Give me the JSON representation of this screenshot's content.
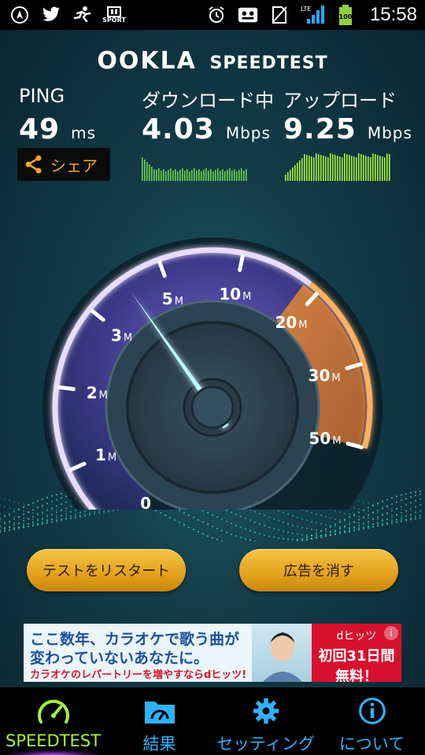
{
  "status_bar": {
    "time": "15:58",
    "network": "LTE",
    "battery": "100",
    "sport_label": "SPORT",
    "icons_left": [
      "navigation-icon",
      "twitter-icon",
      "runner-icon",
      "sport-app-icon"
    ],
    "icons_right": [
      "alarm-icon",
      "voicemail-icon",
      "no-sim-icon",
      "signal-icon",
      "battery-icon"
    ]
  },
  "app": {
    "logo_ookla": "OOKLA",
    "logo_speedtest": "SPEEDTEST",
    "ping": {
      "label": "PING",
      "value": "49",
      "unit": "ms"
    },
    "download": {
      "label": "ダウンロード中",
      "value": "4.03",
      "unit": "Mbps"
    },
    "upload": {
      "label": "アップロード",
      "value": "9.25",
      "unit": "Mbps"
    },
    "share_label": "シェア",
    "gauge": {
      "ticks": [
        {
          "num": "0",
          "suffix": ""
        },
        {
          "num": "1",
          "suffix": "M"
        },
        {
          "num": "2",
          "suffix": "M"
        },
        {
          "num": "3",
          "suffix": "M"
        },
        {
          "num": "5",
          "suffix": "M"
        },
        {
          "num": "10",
          "suffix": "M"
        },
        {
          "num": "20",
          "suffix": "M"
        },
        {
          "num": "30",
          "suffix": "M"
        },
        {
          "num": "50",
          "suffix": "M"
        }
      ],
      "current_mbps": 4.03
    },
    "restart_button": "テストをリスタート",
    "remove_ads_button": "広告を消す"
  },
  "ad": {
    "line1": "ここ数年、カラオケで歌う曲が",
    "line2": "変わっていないあなたに。",
    "line3": "カラオケのレパートリーを増やすならdヒッツ!",
    "brand": "dヒッツ",
    "offer1": "初回31日間",
    "offer2": "無料！",
    "info": "i"
  },
  "nav": {
    "items": [
      {
        "label": "SPEEDTEST",
        "icon": "speedometer-icon"
      },
      {
        "label": "結果",
        "icon": "results-folder-icon"
      },
      {
        "label": "セッティング",
        "icon": "gear-icon"
      },
      {
        "label": "について",
        "icon": "info-icon"
      }
    ]
  },
  "colors": {
    "accent_green": "#a6f23c",
    "accent_blue": "#2fb1ff",
    "share_orange": "#f5a623",
    "gauge_purple": "#b584ff",
    "gauge_orange": "#ff9a3a"
  }
}
